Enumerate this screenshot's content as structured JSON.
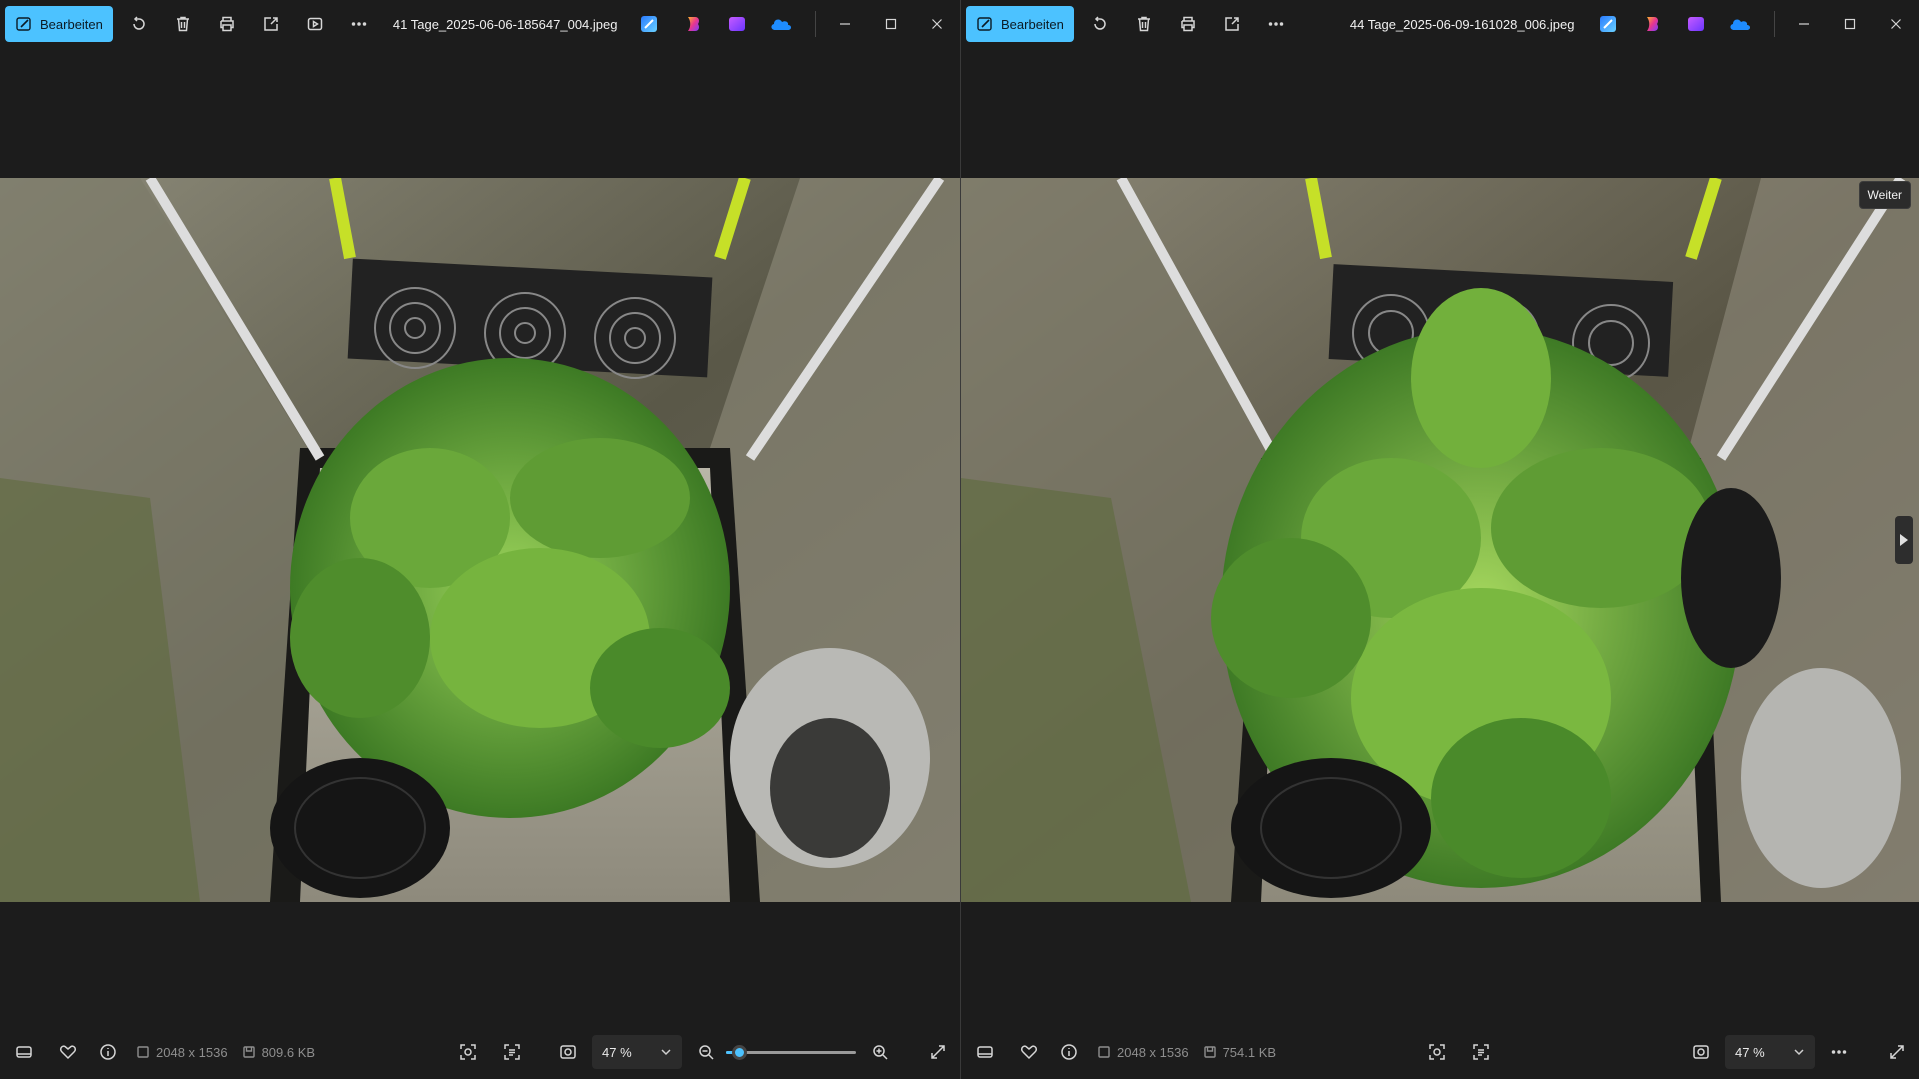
{
  "left_window": {
    "toolbar": {
      "edit_label": "Bearbeiten",
      "filename": "41 Tage_2025-06-06-185647_004.jpeg",
      "icons": [
        "edit-icon",
        "rotate-icon",
        "delete-icon",
        "print-icon",
        "share-icon",
        "slideshow-icon",
        "more-icon"
      ]
    },
    "apps": [
      "designer-app",
      "copilot-app",
      "clipchamp-app",
      "onedrive-app"
    ],
    "status": {
      "dimensions": "2048 x 1536",
      "file_size": "809.6 KB",
      "zoom": "47 %",
      "zoom_fraction": 0.1
    },
    "photo_description_icons": [
      "leaf",
      "fan",
      "tent"
    ]
  },
  "right_window": {
    "toolbar": {
      "edit_label": "Bearbeiten",
      "filename": "44 Tage_2025-06-09-161028_006.jpeg"
    },
    "status": {
      "dimensions": "2048 x 1536",
      "file_size": "754.1 KB",
      "zoom": "47 %"
    },
    "tooltip": "Weiter"
  },
  "colors": {
    "accent": "#4cc2ff",
    "background": "#1c1c1c"
  }
}
